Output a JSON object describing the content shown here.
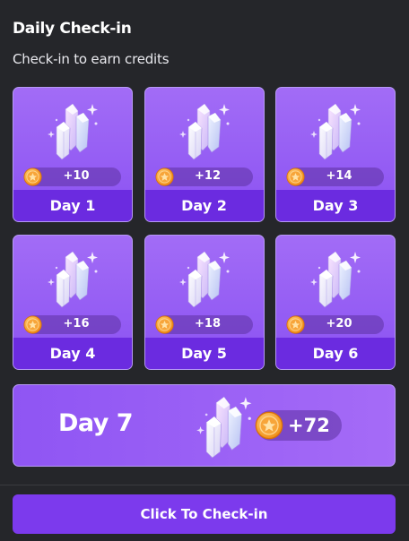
{
  "header": {
    "title": "Daily Check-in",
    "subtitle": "Check-in to earn credits"
  },
  "days": [
    {
      "label": "Day 1",
      "reward": "+10"
    },
    {
      "label": "Day 2",
      "reward": "+12"
    },
    {
      "label": "Day 3",
      "reward": "+14"
    },
    {
      "label": "Day 4",
      "reward": "+16"
    },
    {
      "label": "Day 5",
      "reward": "+18"
    },
    {
      "label": "Day 6",
      "reward": "+20"
    }
  ],
  "day7": {
    "label": "Day 7",
    "reward": "+72"
  },
  "checkin_button": {
    "label": "Click To Check-in"
  },
  "icons": {
    "reward": "crystal-icon",
    "currency": "coin-icon"
  },
  "colors": {
    "background": "#25262a",
    "card": "#9a62f5",
    "card_footer": "#6b2be0",
    "button": "#7c3aed",
    "coin": "#f5a623"
  }
}
